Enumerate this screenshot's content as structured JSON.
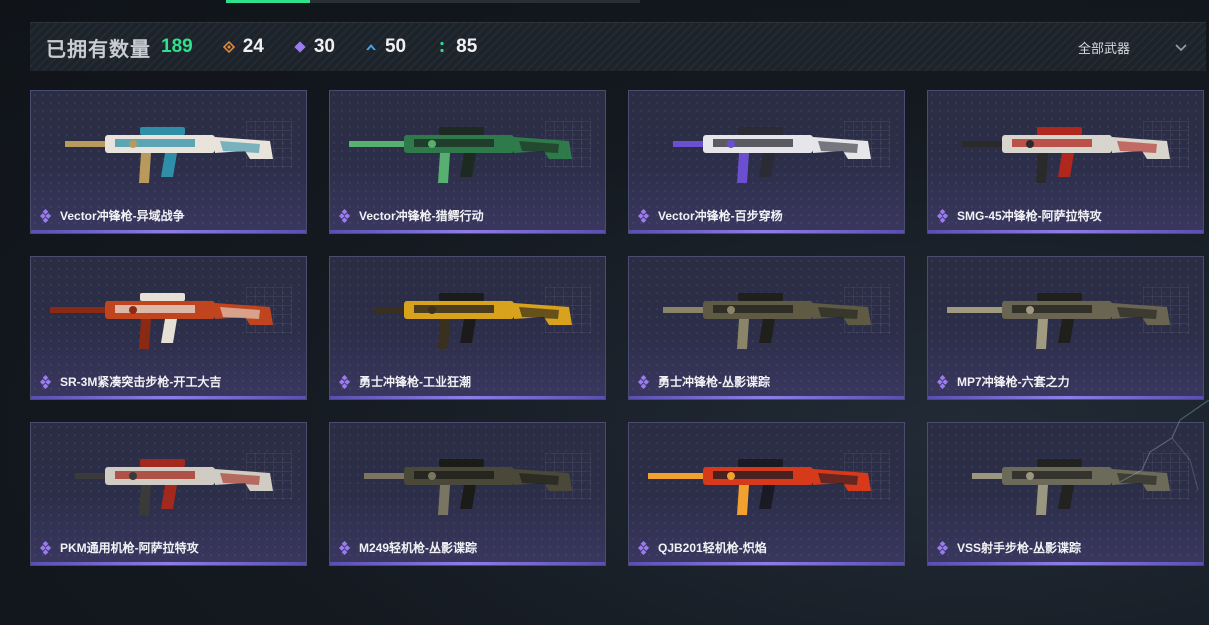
{
  "header": {
    "owned_label": "已拥有数量",
    "owned_total": "189",
    "stats": [
      {
        "icon": "orange-diamond-icon",
        "color": "#e08a3c",
        "value": "24"
      },
      {
        "icon": "purple-diamond-icon",
        "color": "#9a7cf0",
        "value": "30"
      },
      {
        "icon": "blue-chevron-icon",
        "color": "#4aa3e8",
        "value": "50"
      },
      {
        "icon": "green-dots-icon",
        "color": "#2fe08c",
        "value": "85"
      }
    ],
    "filter_label": "全部武器"
  },
  "colors": {
    "accent": "#2fe08c",
    "rarity_purple": "#9a7cf0"
  },
  "weapons": [
    {
      "name": "Vector冲锋枪-异域战争",
      "skin_colors": [
        "#e8e4dc",
        "#2f8fa8",
        "#b79a5c"
      ]
    },
    {
      "name": "Vector冲锋枪-猎鳄行动",
      "skin_colors": [
        "#2e7a4a",
        "#1d2a22",
        "#58b070"
      ]
    },
    {
      "name": "Vector冲锋枪-百步穿杨",
      "skin_colors": [
        "#e6e6ea",
        "#2b2b35",
        "#6a4fd0"
      ]
    },
    {
      "name": "SMG-45冲锋枪-阿萨拉特攻",
      "skin_colors": [
        "#d8d4ce",
        "#b0271e",
        "#2a2a2a"
      ]
    },
    {
      "name": "SR-3M紧凑突击步枪-开工大吉",
      "skin_colors": [
        "#c0451e",
        "#e6e0d6",
        "#8a2a14"
      ]
    },
    {
      "name": "勇士冲锋枪-工业狂潮",
      "skin_colors": [
        "#d9a21c",
        "#1b1b1b",
        "#3a3020"
      ]
    },
    {
      "name": "勇士冲锋枪-丛影谍踪",
      "skin_colors": [
        "#5e5a44",
        "#1f1f1c",
        "#8a8468"
      ]
    },
    {
      "name": "MP7冲锋枪-六套之力",
      "skin_colors": [
        "#6a6452",
        "#1f1f1c",
        "#a09a80"
      ]
    },
    {
      "name": "PKM通用机枪-阿萨拉特攻",
      "skin_colors": [
        "#d0ccc4",
        "#a3281e",
        "#3a3a3a"
      ]
    },
    {
      "name": "M249轻机枪-丛影谍踪",
      "skin_colors": [
        "#4a4838",
        "#1b1b18",
        "#7a7560"
      ]
    },
    {
      "name": "QJB201轻机枪-炽焰",
      "skin_colors": [
        "#d63a1a",
        "#1a1a24",
        "#f2a030"
      ]
    },
    {
      "name": "VSS射手步枪-丛影谍踪",
      "skin_colors": [
        "#6c6a58",
        "#222220",
        "#9a9680"
      ]
    }
  ]
}
